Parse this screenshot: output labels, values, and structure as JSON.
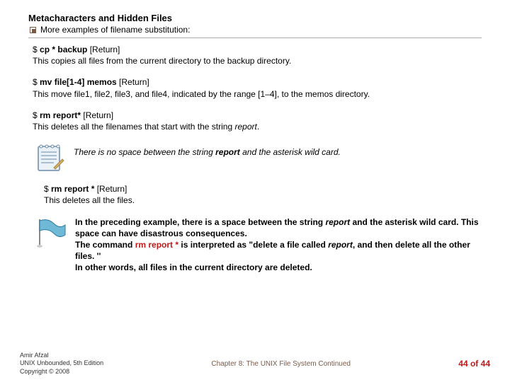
{
  "title": "Metacharacters and Hidden Files",
  "bullet": "More examples of filename substitution:",
  "examples": [
    {
      "prompt": "$ ",
      "cmd_bold": "cp * backup",
      "cmd_tail": " [Return]",
      "desc": "This copies all files from the current directory to the backup directory."
    },
    {
      "prompt": "$ ",
      "cmd_bold": "mv file[1-4] memos",
      "cmd_tail": " [Return]",
      "desc": "This move file1, file2, file3, and file4, indicated by the range [1–4], to the memos directory."
    },
    {
      "prompt": "$ ",
      "cmd_bold": "rm report*",
      "cmd_tail": " [Return]",
      "desc_pre": "This deletes all the filenames that start with the string ",
      "desc_ital": "report",
      "desc_post": "."
    }
  ],
  "note": {
    "pre": "There is no space between the string ",
    "bold": "report",
    "post": " and the asterisk wild card."
  },
  "example4": {
    "prompt": "$ ",
    "cmd_bold": "rm report *",
    "cmd_tail": " [Return]",
    "desc": "This deletes all the files."
  },
  "warning": {
    "line1_pre": "In the preceding example, there is a space between the string ",
    "line1_ital": "report",
    "line1_post": " and the asterisk wild card. This space can have disastrous consequences.",
    "line2_pre": "The command ",
    "line2_cmd": "rm report *",
    "line2_post": " is interpreted as \"delete a file called ",
    "line2_ital": "report",
    "line2_post2": ", and then delete all the other files. ''",
    "line3": "In other words, all files in the current directory are deleted."
  },
  "footer": {
    "author": "Amir Afzal",
    "book": "UNIX Unbounded, 5th Edition",
    "copyright": "Copyright © 2008",
    "chapter": "Chapter 8: The UNIX File System Continued",
    "page_current": "44",
    "page_sep": " of ",
    "page_total": "44"
  }
}
